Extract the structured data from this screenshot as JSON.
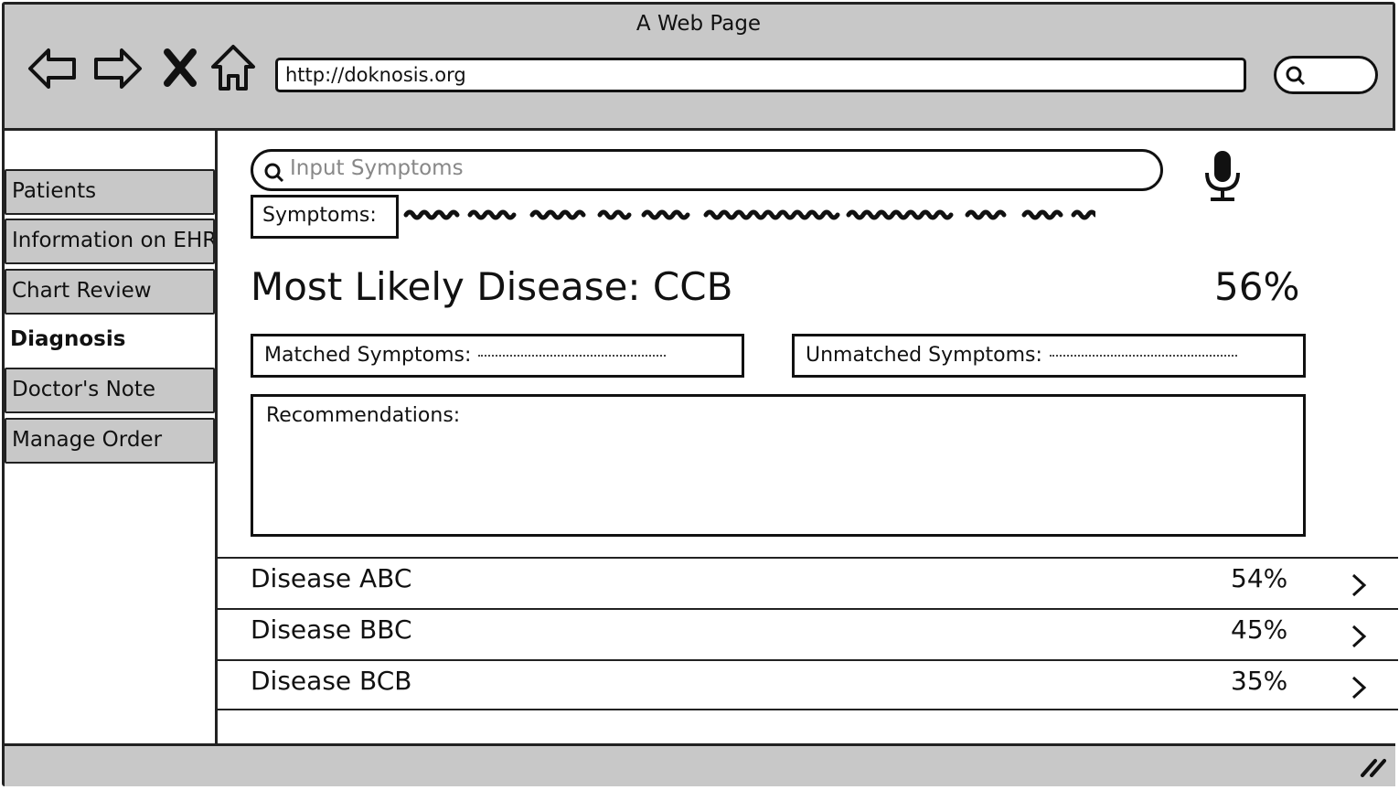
{
  "window": {
    "title": "A Web Page",
    "url": "http://doknosis.org"
  },
  "icons": {
    "back": "back-arrow-icon",
    "forward": "forward-arrow-icon",
    "stop": "close-icon",
    "home": "home-icon",
    "search": "search-icon",
    "mic": "microphone-icon",
    "chevron": "chevron-right-icon",
    "resize": "resize-grip-icon"
  },
  "sidebar": {
    "items": [
      {
        "label": "Patients"
      },
      {
        "label": "Information on EHR"
      },
      {
        "label": "Chart Review"
      },
      {
        "label": "Diagnosis"
      },
      {
        "label": "Doctor's Note"
      },
      {
        "label": "Manage Order"
      }
    ],
    "active": "Diagnosis"
  },
  "main": {
    "symptom_input_placeholder": "Input Symptoms",
    "symptoms_label": "Symptoms:",
    "most_likely_label": "Most Likely Disease: CCB",
    "most_likely_pct": "56%",
    "matched_label": "Matched Symptoms:",
    "unmatched_label": "Unmatched Symptoms:",
    "recommendations_label": "Recommendations:",
    "diseases": [
      {
        "name": "Disease ABC",
        "pct": "54%"
      },
      {
        "name": "Disease BBC",
        "pct": "45%"
      },
      {
        "name": "Disease BCB",
        "pct": "35%"
      }
    ]
  },
  "colors": {
    "chrome": "#c8c8c8",
    "ink": "#111111",
    "placeholder": "#888888"
  }
}
